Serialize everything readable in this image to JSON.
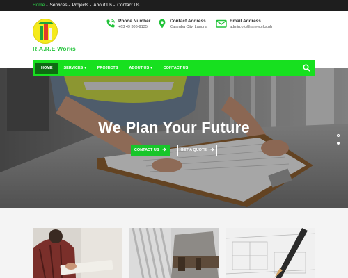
{
  "topbar": {
    "links": [
      "Home",
      "Services",
      "Projects",
      "About Us",
      "Contact Us"
    ],
    "separator": "-",
    "active_link": "Home"
  },
  "brand": {
    "name": "R.A.R.E Works"
  },
  "contact": {
    "phone": {
      "title": "Phone Number",
      "value": "+63 49 306-9135",
      "icon": "phone-icon"
    },
    "address": {
      "title": "Contact Address",
      "value": "Calamba City, Laguna",
      "icon": "map-pin-icon"
    },
    "email": {
      "title": "Email Address",
      "value": "admin.ofc@rareworks.ph",
      "icon": "envelope-icon"
    }
  },
  "nav": {
    "items": [
      {
        "label": "HOME",
        "dropdown": false
      },
      {
        "label": "SERVICES",
        "dropdown": true
      },
      {
        "label": "PROJECTS",
        "dropdown": false
      },
      {
        "label": "ABOUT US",
        "dropdown": true
      },
      {
        "label": "CONTACT US",
        "dropdown": false
      }
    ],
    "search_icon": "search-icon"
  },
  "hero": {
    "headline": "We Plan Your Future",
    "contact_button": "CONTACT US",
    "quote_button": "GET A QUOTE",
    "arrow_icon": "arrow-right-icon",
    "slides": 2,
    "active_slide": 2
  },
  "colors": {
    "accent": "#17e01f",
    "nav_active": "#0e6b12",
    "brand": "#22c33a",
    "topbar": "#1e1e1e"
  }
}
